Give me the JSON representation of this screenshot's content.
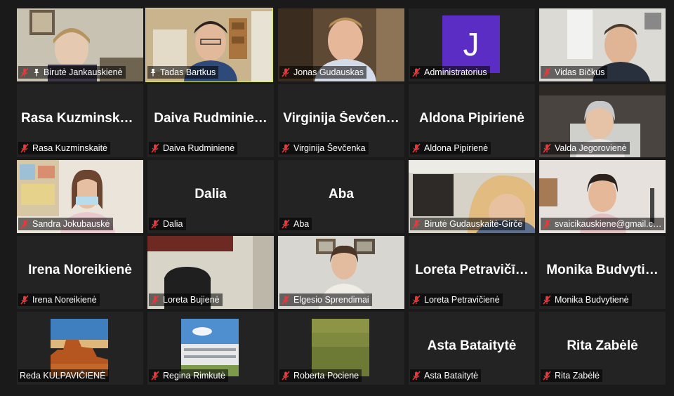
{
  "colors": {
    "background": "#1a1a1a",
    "tile": "#232323",
    "active_border": "#d6e74a",
    "mic_muted": "#e23b3b",
    "avatar": "#5b2dc4"
  },
  "participants": [
    {
      "label": "Birutė Jankauskienė",
      "pinned": true,
      "video": "person-video"
    },
    {
      "label": "Tadas Bartkus",
      "pinned": true,
      "video": "person-video",
      "active": true
    },
    {
      "label": "Jonas Gudauskas",
      "video": "person-video"
    },
    {
      "label": "Administratorius",
      "avatar_letter": "J"
    },
    {
      "label": "Vidas Bičkus",
      "video": "person-video"
    },
    {
      "label": "Rasa Kuzminskaitė",
      "big_name": "Rasa  Kuzminska…"
    },
    {
      "label": "Daiva Rudminienė",
      "big_name": "Daiva  Rudminie…"
    },
    {
      "label": "Virginija Ševčenka",
      "big_name": "Virginija  Ševčen…"
    },
    {
      "label": "Aldona Pipirienė",
      "big_name": "Aldona  Pipirienė"
    },
    {
      "label": "Valda Jegorovienė",
      "video": "person-video"
    },
    {
      "label": "Sandra Jokubauskė",
      "video": "person-video"
    },
    {
      "label": "Dalia",
      "big_name": "Dalia"
    },
    {
      "label": "Aba",
      "big_name": "Aba"
    },
    {
      "label": "Birutė Gudauskaitė-Girčė",
      "video": "person-video"
    },
    {
      "label": "svaicikauskiene@gmail.c…",
      "video": "person-video"
    },
    {
      "label": "Irena Noreikienė",
      "big_name": "Irena Noreikienė"
    },
    {
      "label": "Loreta Bujienė",
      "video": "office-video"
    },
    {
      "label": "Elgesio Sprendimai",
      "video": "person-video"
    },
    {
      "label": "Loreta Petravičienė",
      "big_name": "Loreta  Petravičī…"
    },
    {
      "label": "Monika Budvytienė",
      "big_name": "Monika  Budvyti…"
    },
    {
      "label": "Reda KULPAVIČIENĖ",
      "thumb": "desert-photo"
    },
    {
      "label": "Regina Rimkutė",
      "thumb": "building-photo"
    },
    {
      "label": "Roberta Pociene",
      "thumb": "grass-photo"
    },
    {
      "label": "Asta Bataitytė",
      "big_name": "Asta Bataitytė"
    },
    {
      "label": "Rita Zabėlė",
      "big_name": "Rita Zabėlė"
    }
  ]
}
